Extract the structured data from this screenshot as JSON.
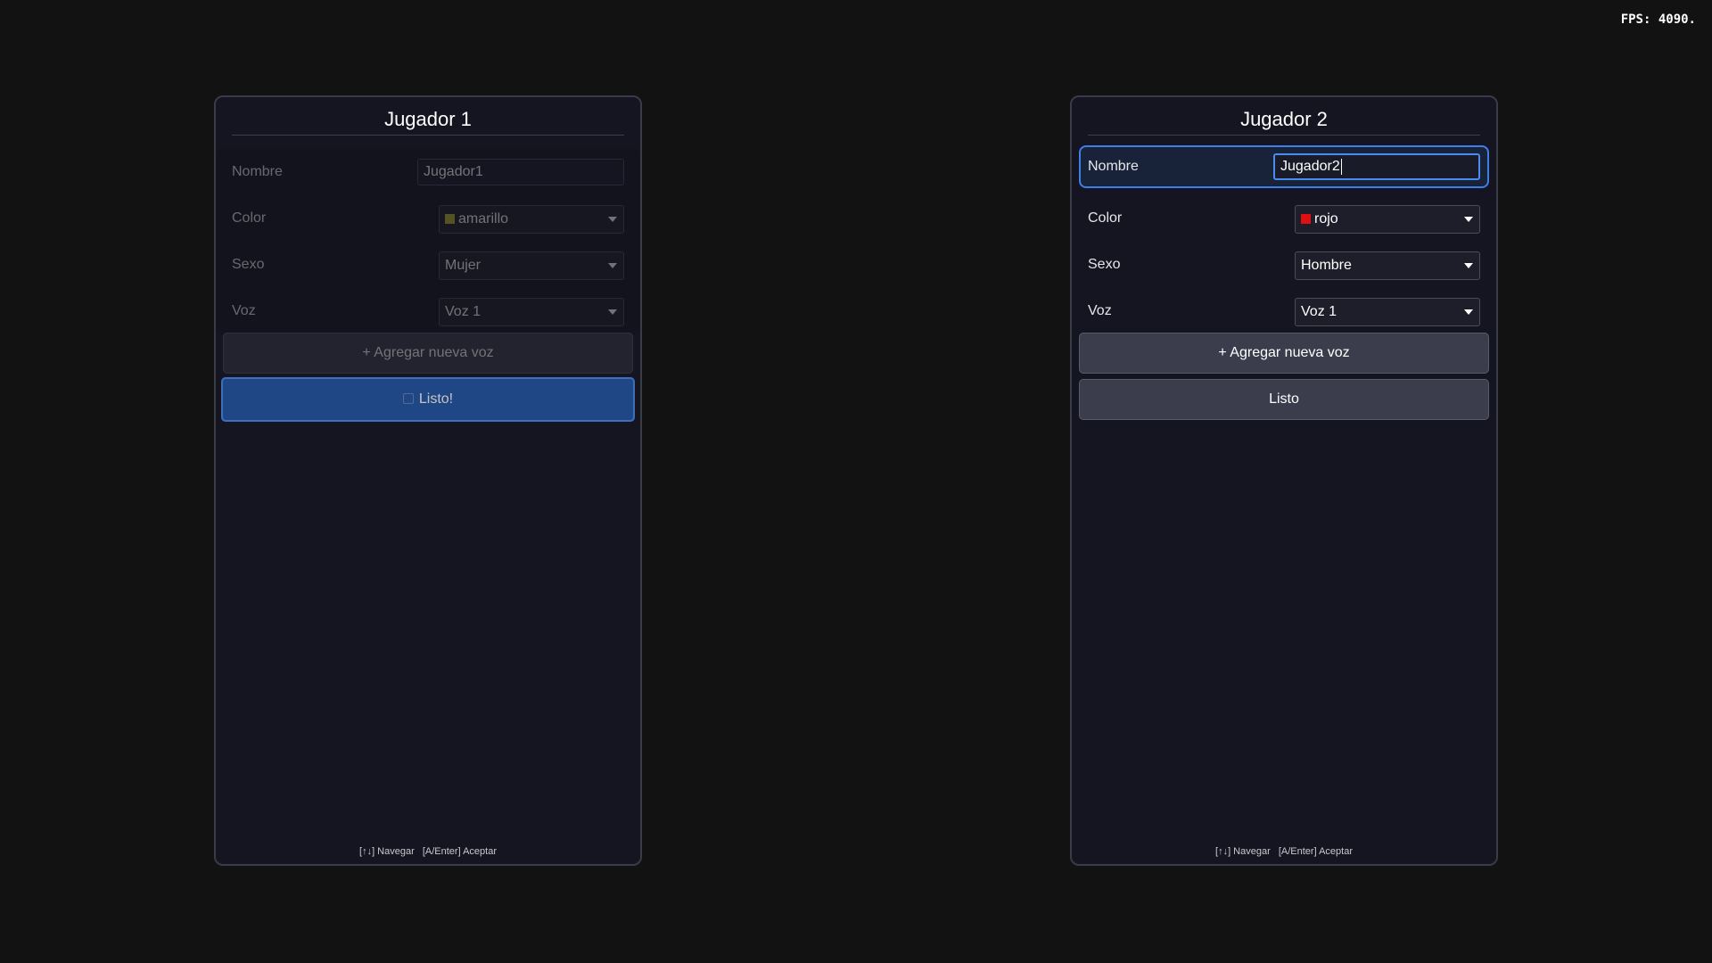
{
  "fps": "FPS: 4090.",
  "hint": {
    "navigate": "[↑↓] Navegar",
    "accept": "[A/Enter] Aceptar"
  },
  "player1": {
    "title": "Jugador 1",
    "name_label": "Nombre",
    "name_value": "Jugador1",
    "color_label": "Color",
    "color_value": "amarillo",
    "color_swatch": "#b5b52e",
    "sex_label": "Sexo",
    "sex_value": "Mujer",
    "voice_label": "Voz",
    "voice_value": "Voz 1",
    "add_voice_label": "+ Agregar nueva voz",
    "ready_label": "Listo!"
  },
  "player2": {
    "title": "Jugador 2",
    "name_label": "Nombre",
    "name_value": "Jugador2",
    "color_label": "Color",
    "color_value": "rojo",
    "color_swatch": "#e01010",
    "sex_label": "Sexo",
    "sex_value": "Hombre",
    "voice_label": "Voz",
    "voice_value": "Voz 1",
    "add_voice_label": "+ Agregar nueva voz",
    "ready_label": "Listo"
  }
}
